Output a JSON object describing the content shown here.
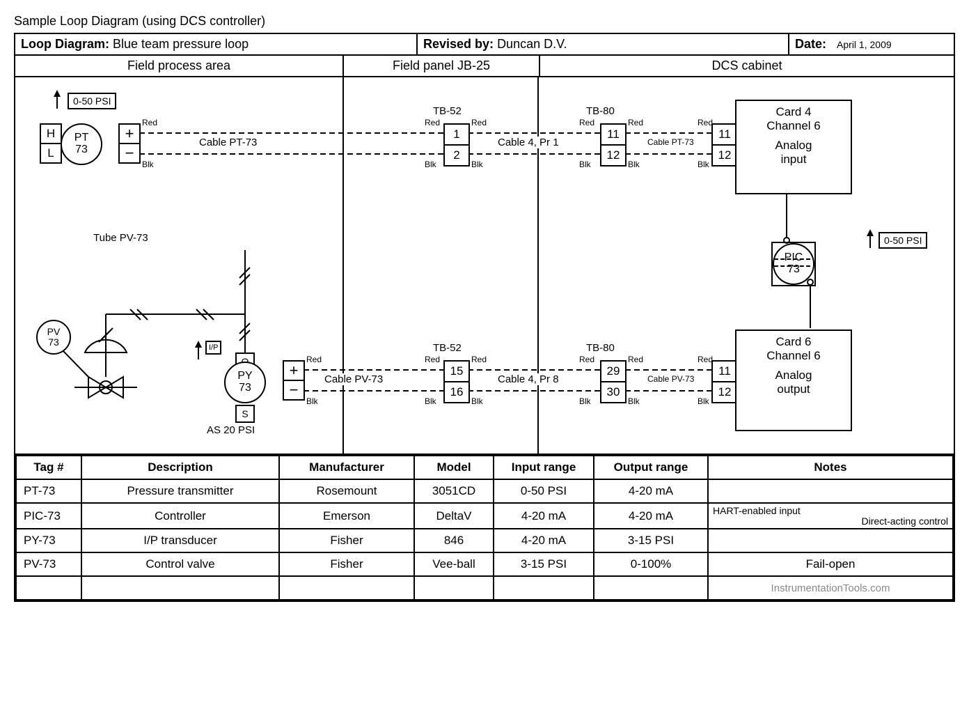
{
  "page_title": "Sample Loop Diagram (using DCS controller)",
  "header": {
    "loop_label": "Loop Diagram:",
    "loop_name": "Blue team pressure loop",
    "revised_label": "Revised by:",
    "revised_by": "Duncan D.V.",
    "date_label": "Date:",
    "date_value": "April 1, 2009"
  },
  "sections": {
    "field": "Field process area",
    "panel": "Field panel JB-25",
    "dcs": "DCS cabinet"
  },
  "signals": {
    "pt_range": "0-50 PSI",
    "pic_range": "0-50 PSI",
    "tube_label": "Tube PV-73",
    "as_label": "AS 20 PSI",
    "ip_label": "I/P",
    "cable_in": "Cable PT-73",
    "cable_out": "Cable PV-73",
    "cable4_pr1": "Cable 4, Pr 1",
    "cable4_pr8": "Cable 4, Pr 8",
    "cable_in2": "Cable PT-73",
    "cable_out2": "Cable PV-73",
    "red": "Red",
    "blk": "Blk",
    "H": "H",
    "L": "L",
    "plus": "+",
    "minus": "−",
    "O": "O",
    "S": "S"
  },
  "bubbles": {
    "pt": {
      "tag": "PT",
      "num": "73"
    },
    "py": {
      "tag": "PY",
      "num": "73"
    },
    "pv": {
      "tag": "PV",
      "num": "73"
    },
    "pic": {
      "tag": "PIC",
      "num": "73"
    }
  },
  "tb": {
    "tb52": "TB-52",
    "tb80": "TB-80",
    "t1": "1",
    "t2": "2",
    "t15": "15",
    "t16": "16",
    "t11": "11",
    "t12": "12",
    "t29": "29",
    "t30": "30",
    "c11": "11",
    "c12": "12"
  },
  "cards": {
    "in": {
      "l1": "Card 4",
      "l2": "Channel 6",
      "l3": "Analog",
      "l4": "input"
    },
    "out": {
      "l1": "Card 6",
      "l2": "Channel 6",
      "l3": "Analog",
      "l4": "output"
    }
  },
  "table": {
    "headers": [
      "Tag #",
      "Description",
      "Manufacturer",
      "Model",
      "Input range",
      "Output range",
      "Notes"
    ],
    "rows": [
      {
        "tag": "PT-73",
        "desc": "Pressure transmitter",
        "mfr": "Rosemount",
        "model": "3051CD",
        "in": "0-50 PSI",
        "out": "4-20 mA",
        "notes": ""
      },
      {
        "tag": "PIC-73",
        "desc": "Controller",
        "mfr": "Emerson",
        "model": "DeltaV",
        "in": "4-20 mA",
        "out": "4-20 mA",
        "notes": "HART-enabled input|Direct-acting control"
      },
      {
        "tag": "PY-73",
        "desc": "I/P transducer",
        "mfr": "Fisher",
        "model": "846",
        "in": "4-20 mA",
        "out": "3-15 PSI",
        "notes": ""
      },
      {
        "tag": "PV-73",
        "desc": "Control valve",
        "mfr": "Fisher",
        "model": "Vee-ball",
        "in": "3-15 PSI",
        "out": "0-100%",
        "notes": "Fail-open"
      },
      {
        "tag": "",
        "desc": "",
        "mfr": "",
        "model": "",
        "in": "",
        "out": "",
        "notes": "InstrumentationTools.com"
      }
    ]
  }
}
